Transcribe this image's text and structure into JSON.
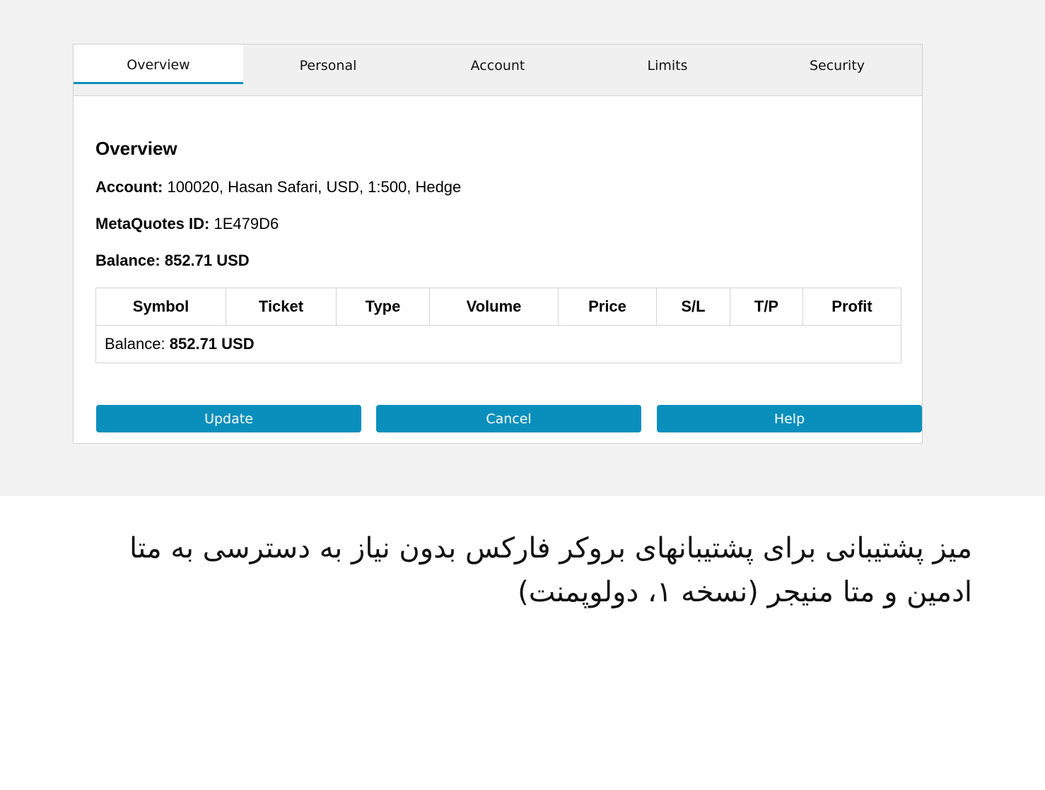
{
  "tabs": [
    "Overview",
    "Personal",
    "Account",
    "Limits",
    "Security"
  ],
  "active_tab": "Overview",
  "overview": {
    "title": "Overview",
    "account_label": "Account:",
    "account_value": "100020, Hasan Safari, USD, 1:500, Hedge",
    "metaquotes_label": "MetaQuotes ID:",
    "metaquotes_value": "1E479D6",
    "balance_label": "Balance:",
    "balance_value": "852.71 USD"
  },
  "table": {
    "headers": [
      "Symbol",
      "Ticket",
      "Type",
      "Volume",
      "Price",
      "S/L",
      "T/P",
      "Profit"
    ],
    "footer_label": "Balance:",
    "footer_value": "852.71 USD"
  },
  "buttons": {
    "update": "Update",
    "cancel": "Cancel",
    "help": "Help"
  },
  "colors": {
    "accent": "#0a8fbd",
    "tab_bar": "#f0f0f0",
    "page_bg": "#f2f2f2"
  },
  "caption": "میز پشتیبانی برای پشتیبانهای بروکر فارکس بدون نیاز به دسترسی به متا ادمین و متا منیجر (نسخه ۱، دولوپمنت)"
}
